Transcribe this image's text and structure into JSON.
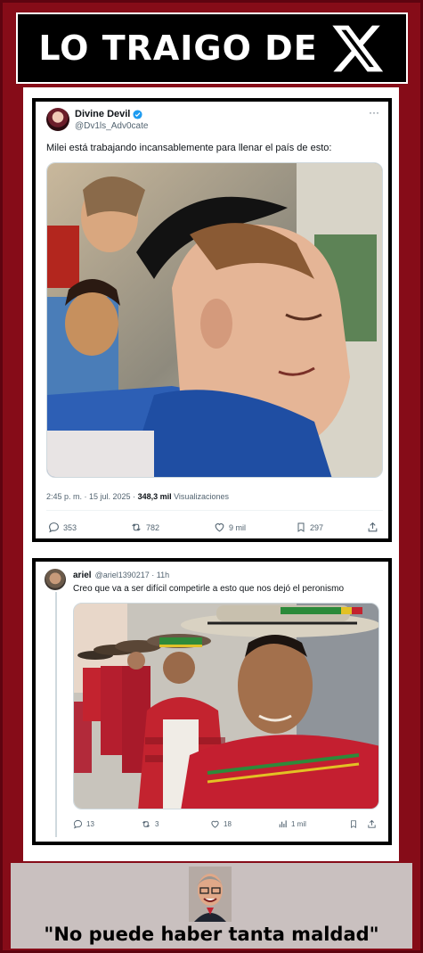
{
  "header": {
    "title": "LO TRAIGO DE",
    "logo_icon": "x-logo-icon"
  },
  "tweet1": {
    "name": "Divine Devil",
    "handle": "@Dv1ls_Adv0cate",
    "verified": true,
    "text": "Milei está trabajando incansablemente para llenar el país de esto:",
    "timestamp": "2:45 p. m. · 15 jul. 2025 · ",
    "views": "348,3 mil",
    "views_label": " Visualizaciones",
    "replies": "353",
    "reposts": "782",
    "likes": "9 mil",
    "bookmarks": "297"
  },
  "tweet2": {
    "name": "ariel",
    "handle": "@ariel1390217 · 11h",
    "text": "Creo que va a ser difícil competirle a esto que nos dejó el peronismo",
    "replies": "13",
    "reposts": "3",
    "likes": "18",
    "views": "1 mil"
  },
  "footer": {
    "quote": "\"No puede haber tanta maldad\""
  },
  "colors": {
    "frame": "#860c18",
    "x_blue": "#1d9bf0"
  }
}
